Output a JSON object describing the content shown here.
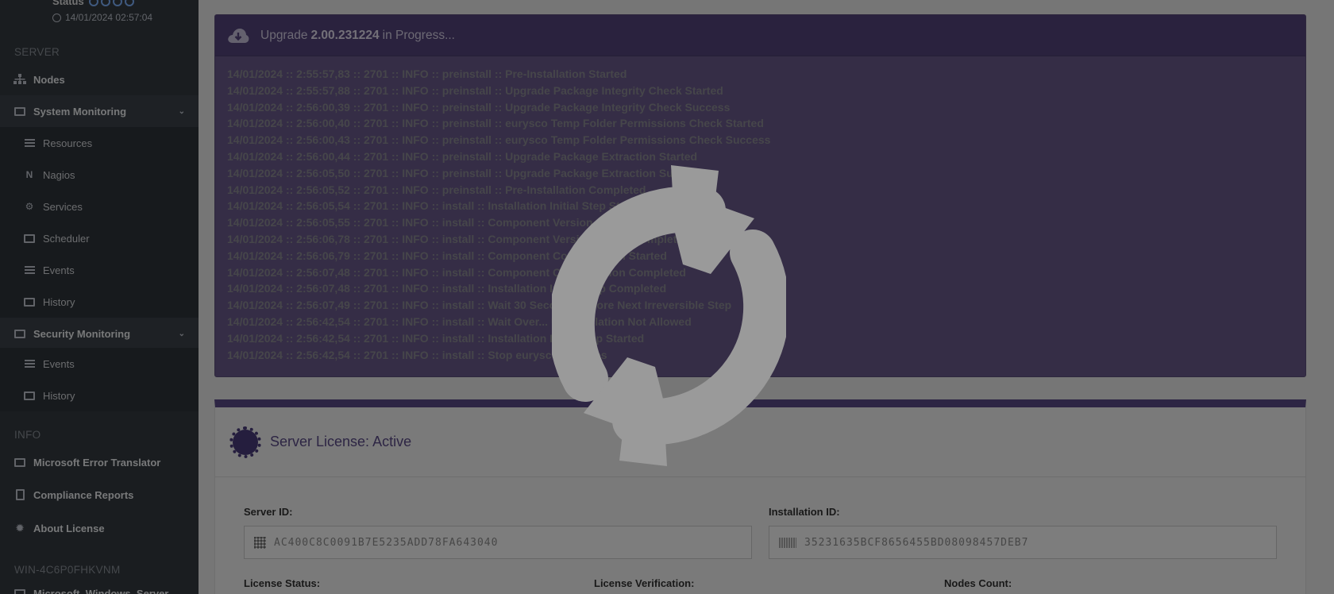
{
  "sidebar": {
    "status_label": "Status",
    "status_time": "14/01/2024 02:57:04",
    "server_header": "SERVER",
    "nodes": "Nodes",
    "system_monitoring": "System Monitoring",
    "resources": "Resources",
    "nagios": "Nagios",
    "services": "Services",
    "scheduler": "Scheduler",
    "events": "Events",
    "history": "History",
    "security_monitoring": "Security Monitoring",
    "sec_events": "Events",
    "sec_history": "History",
    "info_header": "INFO",
    "error_translator": "Microsoft Error Translator",
    "compliance": "Compliance Reports",
    "about_license": "About License",
    "host_header": "WIN-4C6P0FHKVNM",
    "host_item": "Microsoft_Windows_Server"
  },
  "upgrade": {
    "prefix": "Upgrade",
    "version": "2.00.231224",
    "suffix": "in Progress...",
    "log": [
      "14/01/2024 :: 2:55:57,83 :: 2701 :: INFO :: preinstall :: Pre-Installation Started",
      "14/01/2024 :: 2:55:57,88 :: 2701 :: INFO :: preinstall :: Upgrade Package Integrity Check Started",
      "14/01/2024 :: 2:56:00,39 :: 2701 :: INFO :: preinstall :: Upgrade Package Integrity Check Success",
      "14/01/2024 :: 2:56:00,40 :: 2701 :: INFO :: preinstall :: eurysco Temp Folder Permissions Check Started",
      "14/01/2024 :: 2:56:00,43 :: 2701 :: INFO :: preinstall :: eurysco Temp Folder Permissions Check Success",
      "14/01/2024 :: 2:56:00,44 :: 2701 :: INFO :: preinstall :: Upgrade Package Extraction Started",
      "14/01/2024 :: 2:56:05,50 :: 2701 :: INFO :: preinstall :: Upgrade Package Extraction Success",
      "14/01/2024 :: 2:56:05,52 :: 2701 :: INFO :: preinstall :: Pre-Installation Completed",
      "14/01/2024 :: 2:56:05,54 :: 2701 :: INFO :: install :: Installation Initial Step Started",
      "14/01/2024 :: 2:56:05,55 :: 2701 :: INFO :: install :: Component Version Check",
      "14/01/2024 :: 2:56:06,78 :: 2701 :: INFO :: install :: Component Version Check Completed",
      "14/01/2024 :: 2:56:06,79 :: 2701 :: INFO :: install :: Component Configuration Started",
      "14/01/2024 :: 2:56:07,48 :: 2701 :: INFO :: install :: Component Configuration Completed",
      "14/01/2024 :: 2:56:07,48 :: 2701 :: INFO :: install :: Installation Initial Step Completed",
      "14/01/2024 :: 2:56:07,49 :: 2701 :: INFO :: install :: Wait 30 Seconds Before Next Irreversible Step",
      "14/01/2024 :: 2:56:42,54 :: 2701 :: INFO :: install :: Wait Over... Uninstallation Not Allowed",
      "14/01/2024 :: 2:56:42,54 :: 2701 :: INFO :: install :: Installation Final Step Started",
      "14/01/2024 :: 2:56:42,54 :: 2701 :: INFO :: install :: Stop eurysco Services"
    ]
  },
  "license": {
    "title": "Server License: Active",
    "server_id_label": "Server ID:",
    "server_id": "AC400C8C0091B7E5235ADD78FA643040",
    "installation_id_label": "Installation ID:",
    "installation_id": "35231635BCF8656455BD08098457DEB7",
    "status_label": "License Status:",
    "verification_label": "License Verification:",
    "nodes_count_label": "Nodes Count:"
  },
  "icons": {
    "spinner": "sync-icon",
    "upgrade": "cloud-download-icon",
    "license": "certificate-icon"
  }
}
